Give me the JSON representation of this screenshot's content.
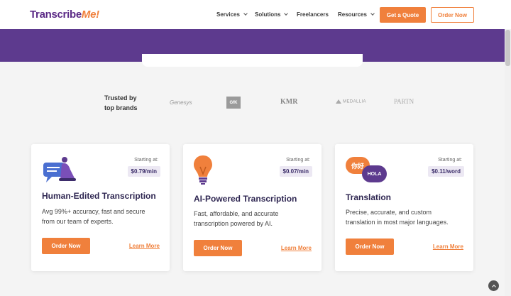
{
  "header": {
    "logo_main": "Transcribe",
    "logo_accent": "Me!",
    "nav": {
      "services": "Services",
      "solutions": "Solutions",
      "freelancers": "Freelancers",
      "resources": "Resources"
    },
    "quote_label": "Get a Quote",
    "order_label": "Order Now"
  },
  "brands": {
    "trusted_line1": "Trusted by",
    "trusted_line2": "top brands",
    "genesys": "Genesys",
    "gfk": "GfK",
    "kmr": "KMR",
    "medallia": "MEDALLIA",
    "partners": "PARTN"
  },
  "cards": [
    {
      "starting_label": "Starting at:",
      "price": "$0.79/min",
      "title": "Human-Edited Transcription",
      "description": "Avg 99%+ accuracy, fast and secure from our team of experts.",
      "order_label": "Order Now",
      "learn_label": "Learn More"
    },
    {
      "starting_label": "Starting at:",
      "price": "$0.07/min",
      "title": "AI-Powered Transcription",
      "description": "Fast, affordable, and accurate transcription powered by AI.",
      "order_label": "Order Now",
      "learn_label": "Learn More"
    },
    {
      "starting_label": "Starting at:",
      "price": "$0.11/word",
      "title": "Translation",
      "description": "Precise, accurate, and custom translation in most major languages.",
      "order_label": "Order Now",
      "learn_label": "Learn More",
      "bubble_cn": "你好",
      "bubble_hola": "HOLA"
    }
  ],
  "colors": {
    "brand_purple": "#5d3a8e",
    "accent_orange": "#f0803c"
  },
  "icons": {
    "scroll_top": "chevron-up-icon"
  }
}
